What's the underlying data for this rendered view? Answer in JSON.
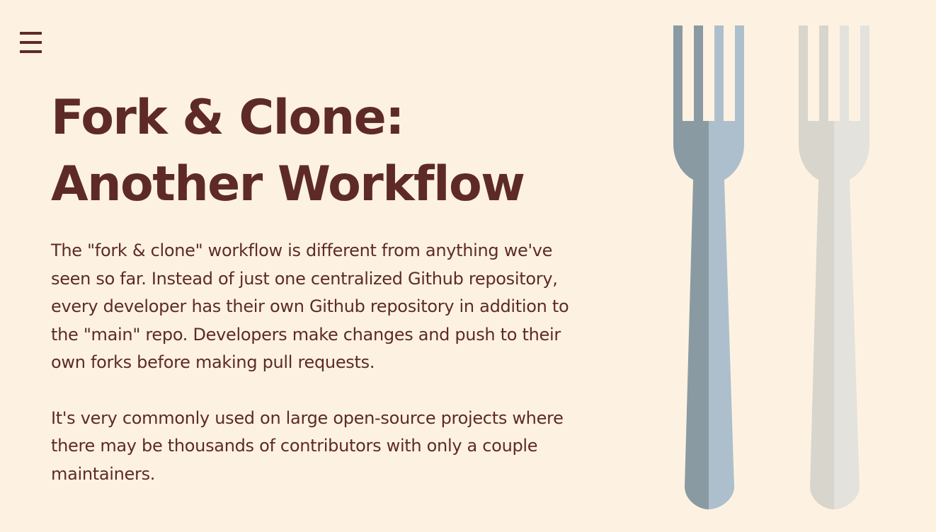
{
  "header": {
    "menu_icon": "hamburger-menu-icon"
  },
  "slide": {
    "title_line_1": "Fork & Clone:",
    "title_line_2": "Another Workflow",
    "paragraph_1": "The \"fork & clone\" workflow is different from anything we've seen so far.  Instead of just one centralized Github repository, every developer has their own Github repository in addition to the \"main\" repo.   Developers make changes and push to their own forks before making pull requests.",
    "paragraph_2": "It's very commonly used on large open-source projects where there may be thousands of contributors with only a couple maintainers."
  },
  "illustration": {
    "icon": "fork-icon",
    "colors": {
      "background": "#fdf2e1",
      "text": "#5e2a27",
      "fork_blue_dark": "#8a9aa3",
      "fork_blue_light": "#adbfcc",
      "fork_grey_dark": "#d7d5cc",
      "fork_grey_light": "#e3e2dc"
    }
  }
}
